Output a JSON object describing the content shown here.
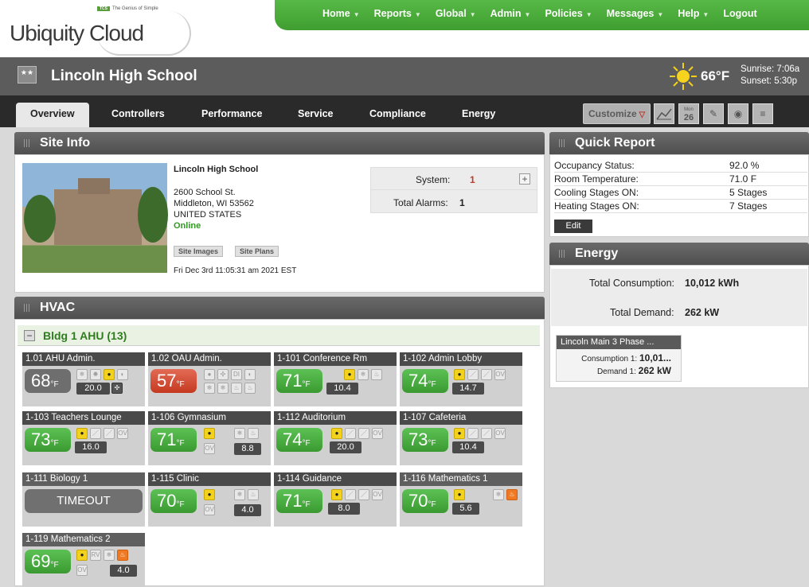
{
  "logo": {
    "tagline_badge": "TCS",
    "tagline": "The Genius of Simple",
    "text": "Ubiquity Cloud"
  },
  "topnav": [
    {
      "label": "Home"
    },
    {
      "label": "Reports"
    },
    {
      "label": "Global"
    },
    {
      "label": "Admin"
    },
    {
      "label": "Policies"
    },
    {
      "label": "Messages"
    },
    {
      "label": "Help"
    },
    {
      "label": "Logout"
    }
  ],
  "site": {
    "name": "Lincoln High School",
    "temp": "66°F",
    "sunrise": "Sunrise: 7:06a",
    "sunset": "Sunset: 5:30p"
  },
  "tabs": [
    "Overview",
    "Controllers",
    "Performance",
    "Service",
    "Compliance",
    "Energy"
  ],
  "toolbar": {
    "customize": "Customize",
    "calendar_month": "Mon",
    "calendar_day": "26"
  },
  "site_info": {
    "title": "Site Info",
    "school": "Lincoln High School",
    "address1": "2600 School St.",
    "address2": "Middleton, WI 53562",
    "country": "UNITED STATES",
    "status": "Online",
    "btn_images": "Site Images",
    "btn_plans": "Site Plans",
    "datetime": "Fri Dec 3rd 11:05:31 am 2021 EST",
    "system_label": "System:",
    "system_value": "1",
    "alarms_label": "Total Alarms:",
    "alarms_value": "1",
    "add_symbol": "+"
  },
  "quick_report": {
    "title": "Quick Report",
    "rows": [
      {
        "label": "Occupancy Status:",
        "value": "92.0 %"
      },
      {
        "label": "Room Temperature:",
        "value": "71.0 F"
      },
      {
        "label": "Cooling Stages ON:",
        "value": "5 Stages"
      },
      {
        "label": "Heating Stages ON:",
        "value": "7 Stages"
      }
    ],
    "edit": "Edit"
  },
  "energy": {
    "title": "Energy",
    "consumption_label": "Total Consumption:",
    "consumption_value": "10,012 kWh",
    "demand_label": "Total Demand:",
    "demand_value": "262 kW",
    "meter": {
      "title": "Lincoln Main 3 Phase ...",
      "consumption_label": "Consumption 1:",
      "consumption_value": "10,01...",
      "demand_label": "Demand 1:",
      "demand_value": "262 kW"
    }
  },
  "hvac": {
    "title": "HVAC",
    "building": "Bldg 1 AHU (13)",
    "minus": "−",
    "units": [
      {
        "name": "1.01 AHU Admin.",
        "temp": "68",
        "setpoint": "20.0",
        "state": "gray"
      },
      {
        "name": "1.02 OAU Admin.",
        "temp": "57",
        "setpoint": "",
        "state": "red"
      },
      {
        "name": "1-101 Conference Rm",
        "temp": "71",
        "setpoint": "10.4",
        "state": "green"
      },
      {
        "name": "1-102 Admin Lobby",
        "temp": "74",
        "setpoint": "14.7",
        "state": "green"
      },
      {
        "name": "1-103 Teachers Lounge",
        "temp": "73",
        "setpoint": "16.0",
        "state": "green"
      },
      {
        "name": "1-106 Gymnasium",
        "temp": "71",
        "setpoint": "8.8",
        "state": "green"
      },
      {
        "name": "1-112 Auditorium",
        "temp": "74",
        "setpoint": "20.0",
        "state": "green"
      },
      {
        "name": "1-107 Cafeteria",
        "temp": "73",
        "setpoint": "10.4",
        "state": "green"
      },
      {
        "name": "1-111 Biology 1",
        "temp": "TIMEOUT",
        "setpoint": "",
        "state": "timeout"
      },
      {
        "name": "1-115 Clinic",
        "temp": "70",
        "setpoint": "4.0",
        "state": "green"
      },
      {
        "name": "1-114 Guidance",
        "temp": "71",
        "setpoint": "8.0",
        "state": "green"
      },
      {
        "name": "1-116 Mathematics 1",
        "temp": "70",
        "setpoint": "5.6",
        "state": "green"
      },
      {
        "name": "1-119 Mathematics 2",
        "temp": "69",
        "setpoint": "4.0",
        "state": "green"
      }
    ],
    "unit_label": "°F"
  },
  "colors": {
    "brand_green": "#4fb23f",
    "alarm_red": "#c0392b",
    "online_green": "#2e9a1e"
  }
}
